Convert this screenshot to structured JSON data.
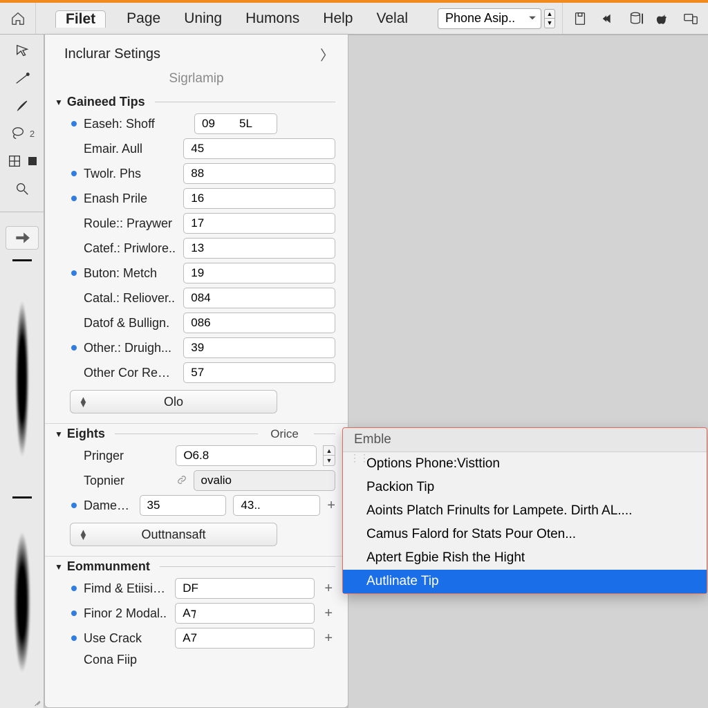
{
  "menubar": {
    "items": [
      "Filet",
      "Page",
      "Uning",
      "Humons",
      "Help",
      "Velal"
    ],
    "active_index": 0
  },
  "device_select": {
    "label": "Phone Asip.."
  },
  "dropdown": {
    "header": "Inclurar Setings",
    "subheader": "Sigrlamip",
    "section1": {
      "title": "Gaineed Tips",
      "rows": [
        {
          "on": true,
          "label": "Easeh: Shoff",
          "v1": "09",
          "v2": "5L"
        },
        {
          "on": false,
          "label": "Emair. Aull",
          "v1": "45"
        },
        {
          "on": true,
          "label": "Twolr. Phs",
          "v1": "88"
        },
        {
          "on": true,
          "label": "Enash Prile",
          "v1": "16"
        },
        {
          "on": false,
          "label": "Roule:: Praywer",
          "v1": "17"
        },
        {
          "on": false,
          "label": "Catef.: Priwlore..",
          "v1": "13"
        },
        {
          "on": true,
          "label": "Buton: Metch",
          "v1": "19"
        },
        {
          "on": false,
          "label": "Catal.: Reliover..",
          "v1": "084"
        },
        {
          "on": false,
          "label": "Datof & Bullign.",
          "v1": "086"
        },
        {
          "on": true,
          "label": "Other.: Druigh...",
          "v1": "39"
        },
        {
          "on": false,
          "label": "Other Cor Reout....",
          "v1": "57"
        }
      ],
      "button": "Olo"
    },
    "section2": {
      "title": "Eights",
      "extra": "Orice",
      "rows": [
        {
          "on": false,
          "label": "Pringer",
          "field": "O6.8",
          "kind": "spinner"
        },
        {
          "on": false,
          "label": "Topnier",
          "field": "ovalio",
          "kind": "muted",
          "link": true
        },
        {
          "on": true,
          "label": "Dame Took",
          "v1": "35",
          "v2": "43..",
          "plus": true
        }
      ],
      "button": "Outtnansaft"
    },
    "section3": {
      "title": "Eommunment",
      "rows": [
        {
          "on": true,
          "label": "Fimd & Etiisigh...",
          "field": "DF",
          "plus": true
        },
        {
          "on": true,
          "label": "Finor 2 Modal..",
          "field": "A⁊",
          "plus": true
        },
        {
          "on": true,
          "label": "Use Crack",
          "field": "A7",
          "plus": true
        },
        {
          "on": false,
          "label": "Cona Fiip"
        }
      ]
    }
  },
  "submenu": {
    "header": "Emble",
    "items": [
      "Options Phone:Visttion",
      "Packion Tip",
      "Aoints Platch Frinults for Lampete. Dirth AL....",
      "Camus Falord for Stats Pour Oten...",
      "Aptert Egbie Rish the Hight",
      "Autlinate Tip"
    ],
    "highlight_index": 5
  }
}
